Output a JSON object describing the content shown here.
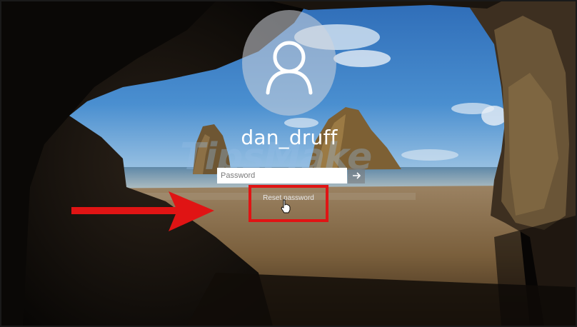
{
  "user": {
    "name": "dan_druff",
    "avatar_icon": "user-silhouette-icon"
  },
  "password_field": {
    "placeholder": "Password",
    "submit_icon": "arrow-right-icon"
  },
  "reset_link": {
    "label": "Reset password"
  },
  "annotation": {
    "highlight_color": "#e01414",
    "arrow_color": "#e01414",
    "arrow_icon": "right-arrow-icon",
    "cursor_icon": "hand-pointer-icon"
  },
  "watermark": {
    "text": "TipsMake",
    "subtext": ".com"
  }
}
